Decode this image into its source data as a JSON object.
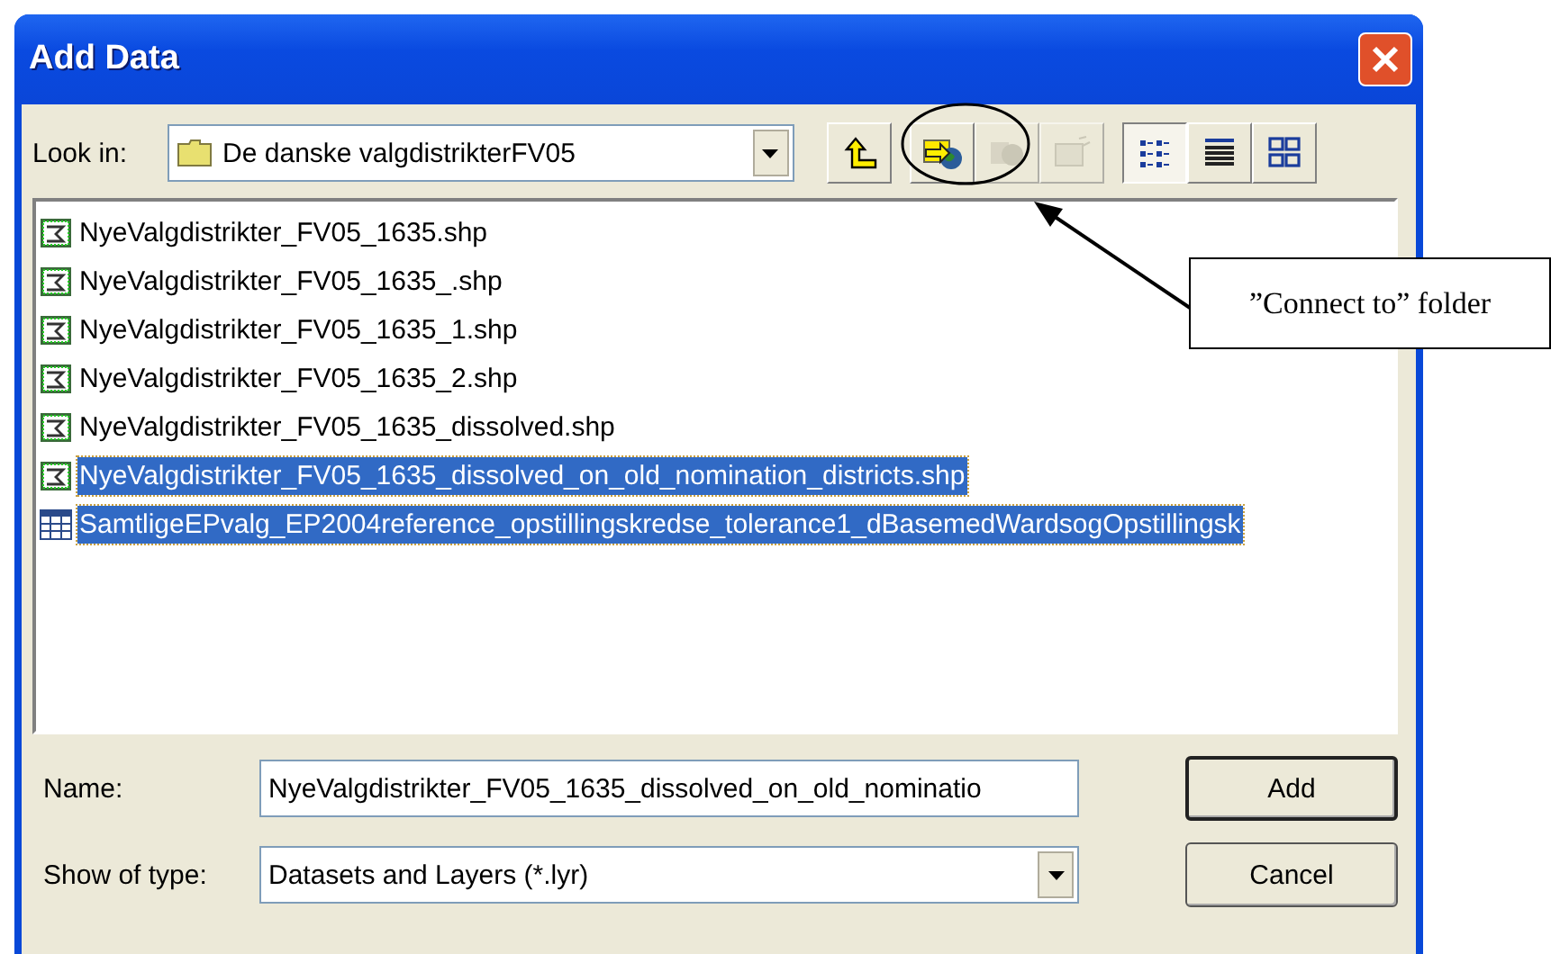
{
  "window": {
    "title": "Add Data"
  },
  "look_in": {
    "label": "Look in:",
    "value": "De danske valgdistrikterFV05"
  },
  "toolbar": [
    {
      "kind": "up",
      "disabled": false,
      "selected": false
    },
    {
      "kind": "connect",
      "disabled": false,
      "selected": false
    },
    {
      "kind": "disconnect",
      "disabled": true,
      "selected": false
    },
    {
      "kind": "new",
      "disabled": true,
      "selected": false
    },
    {
      "kind": "list",
      "disabled": false,
      "selected": true
    },
    {
      "kind": "details",
      "disabled": false,
      "selected": false
    },
    {
      "kind": "thumbnails",
      "disabled": false,
      "selected": false
    }
  ],
  "files": [
    {
      "name": "NyeValgdistrikter_FV05_1635.shp",
      "kind": "shape",
      "selected": false
    },
    {
      "name": "NyeValgdistrikter_FV05_1635_.shp",
      "kind": "shape",
      "selected": false
    },
    {
      "name": "NyeValgdistrikter_FV05_1635_1.shp",
      "kind": "shape",
      "selected": false
    },
    {
      "name": "NyeValgdistrikter_FV05_1635_2.shp",
      "kind": "shape",
      "selected": false
    },
    {
      "name": "NyeValgdistrikter_FV05_1635_dissolved.shp",
      "kind": "shape",
      "selected": false
    },
    {
      "name": "NyeValgdistrikter_FV05_1635_dissolved_on_old_nomination_districts.shp",
      "kind": "shape",
      "selected": true
    },
    {
      "name": "SamtligeEPvalg_EP2004reference_opstillingskredse_tolerance1_dBasemedWardsogOpstillingsk",
      "kind": "table",
      "selected": true
    }
  ],
  "name_field": {
    "label": "Name:",
    "value": "NyeValgdistrikter_FV05_1635_dissolved_on_old_nominatio"
  },
  "type_field": {
    "label": "Show of type:",
    "value": "Datasets and Layers (*.lyr)"
  },
  "buttons": [
    "Add",
    "Cancel"
  ],
  "callout": {
    "text": "”Connect to” folder"
  }
}
